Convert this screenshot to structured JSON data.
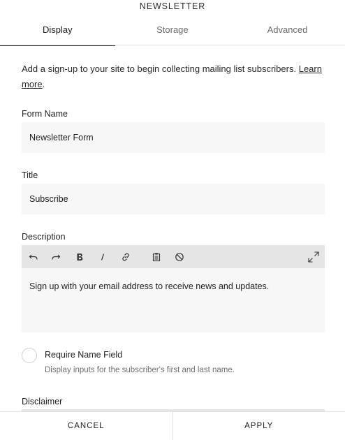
{
  "dialog": {
    "title": "NEWSLETTER"
  },
  "tabs": [
    {
      "label": "Display",
      "active": true
    },
    {
      "label": "Storage",
      "active": false
    },
    {
      "label": "Advanced",
      "active": false
    }
  ],
  "intro": {
    "text": "Add a sign-up to your site to begin collecting mailing list subscribers.",
    "link_label": "Learn more",
    "suffix": "."
  },
  "form_name": {
    "label": "Form Name",
    "value": "Newsletter Form"
  },
  "title_field": {
    "label": "Title",
    "value": "Subscribe"
  },
  "description": {
    "label": "Description",
    "text": "Sign up with your email address to receive news and updates.",
    "toolbar_icons": [
      "undo-icon",
      "redo-icon",
      "bold-icon",
      "italic-icon",
      "link-icon",
      "paste-icon",
      "clear-format-icon",
      "expand-icon"
    ]
  },
  "require_name": {
    "label": "Require Name Field",
    "help": "Display inputs for the subscriber's first and last name.",
    "checked": false
  },
  "disclaimer": {
    "label": "Disclaimer"
  },
  "footer": {
    "cancel_label": "CANCEL",
    "apply_label": "APPLY"
  },
  "colors": {
    "field_bg": "#f7f7f7",
    "toolbar_bg": "#e5e5e5",
    "divider": "#e1e1e1",
    "text": "#1f1f1f"
  }
}
